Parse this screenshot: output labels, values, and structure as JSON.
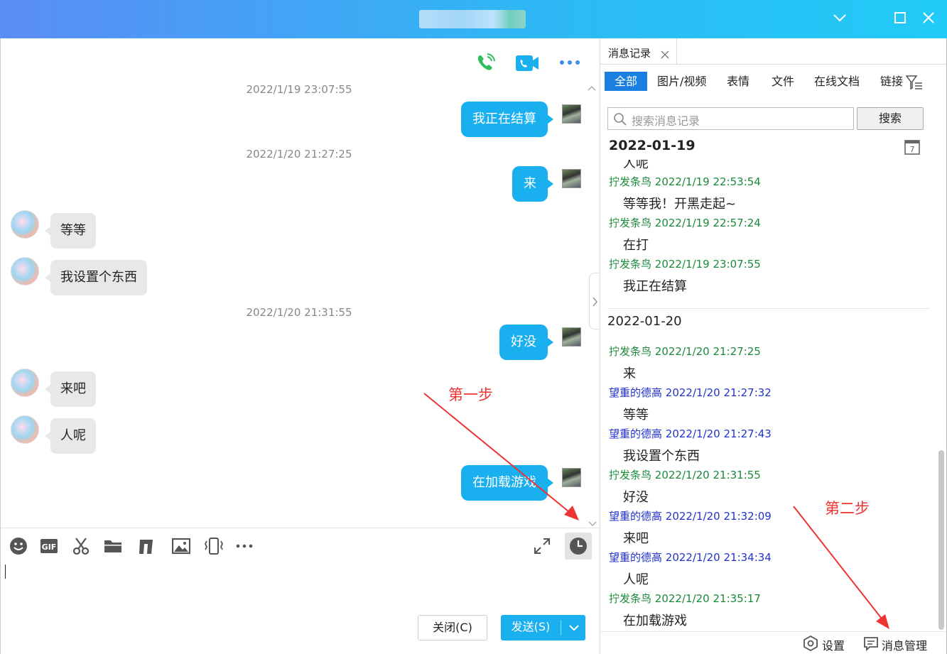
{
  "window": {
    "title": ""
  },
  "chat": {
    "timestamps": [
      "2022/1/19 23:07:55",
      "2022/1/20 21:27:25",
      "2022/1/20 21:31:55"
    ],
    "messages": [
      {
        "side": "right",
        "text": "我正在结算"
      },
      {
        "side": "right",
        "text": "来"
      },
      {
        "side": "left",
        "text": "等等"
      },
      {
        "side": "left",
        "text": "我设置个东西"
      },
      {
        "side": "right",
        "text": "好没"
      },
      {
        "side": "left",
        "text": "来吧"
      },
      {
        "side": "left",
        "text": "人呢"
      },
      {
        "side": "right",
        "text": "在加载游戏"
      }
    ],
    "annotations": {
      "step1": "第一步",
      "step2": "第二步"
    },
    "close_button": "关闭(C)",
    "send_button": "发送(S)"
  },
  "history": {
    "tab_title": "消息记录",
    "filters": [
      "全部",
      "图片/视频",
      "表情",
      "文件",
      "在线文档",
      "链接"
    ],
    "search_placeholder": "搜索消息记录",
    "search_button": "搜索",
    "date1": "2022-01-19",
    "date1_truncated_text": "人呢",
    "date2": "2022-01-20",
    "records": [
      {
        "sender": "拧发条鸟",
        "time": "2022/1/19 22:53:54",
        "text": "等等我！开黑走起~",
        "color": "green"
      },
      {
        "sender": "拧发条鸟",
        "time": "2022/1/19 22:57:24",
        "text": "在打",
        "color": "green"
      },
      {
        "sender": "拧发条鸟",
        "time": "2022/1/19 23:07:55",
        "text": "我正在结算",
        "color": "green"
      },
      {
        "sender": "拧发条鸟",
        "time": "2022/1/20 21:27:25",
        "text": "来",
        "color": "green"
      },
      {
        "sender": "望重的德高",
        "time": "2022/1/20 21:27:32",
        "text": "等等",
        "color": "blue"
      },
      {
        "sender": "望重的德高",
        "time": "2022/1/20 21:27:43",
        "text": "我设置个东西",
        "color": "blue"
      },
      {
        "sender": "拧发条鸟",
        "time": "2022/1/20 21:31:55",
        "text": "好没",
        "color": "green"
      },
      {
        "sender": "望重的德高",
        "time": "2022/1/20 21:32:09",
        "text": "来吧",
        "color": "blue"
      },
      {
        "sender": "望重的德高",
        "time": "2022/1/20 21:34:34",
        "text": "人呢",
        "color": "blue"
      },
      {
        "sender": "拧发条鸟",
        "time": "2022/1/20 21:35:17",
        "text": "在加载游戏",
        "color": "green"
      }
    ],
    "settings": "设置",
    "manage": "消息管理"
  },
  "colors": {
    "accent": "#1ab0f0",
    "green_name": "#1a8a3a",
    "blue_name": "#2233cc",
    "annotation": "#ee3333"
  }
}
